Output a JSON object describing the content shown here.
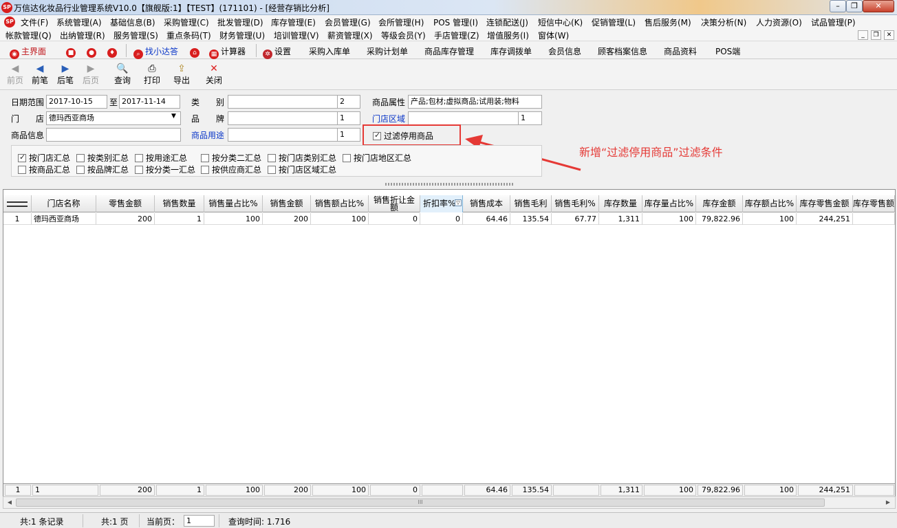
{
  "window": {
    "logo": "SP",
    "title": "万信达化妆品行业管理系统V10.0【旗舰版:1】【TEST】(171101) - [经营存销比分析]",
    "btn_min": "–",
    "btn_restore": "❐",
    "btn_close": "✕"
  },
  "menu1": [
    "文件(F)",
    "系统管理(A)",
    "基础信息(B)",
    "采购管理(C)",
    "批发管理(D)",
    "库存管理(E)",
    "会员管理(G)",
    "会所管理(H)",
    "POS 管理(I)",
    "连锁配送(J)",
    "短信中心(K)",
    "促销管理(L)",
    "售后服务(M)",
    "决策分析(N)",
    "人力资源(O)",
    "试品管理(P)"
  ],
  "menu2": [
    "帐款管理(Q)",
    "出纳管理(R)",
    "服务管理(S)",
    "重点条码(T)",
    "财务管理(U)",
    "培训管理(V)",
    "薪资管理(X)",
    "等级会员(Y)",
    "手店管理(Z)",
    "增值服务(I)",
    "窗体(W)"
  ],
  "mdi": {
    "minimize": "_",
    "restore": "❐",
    "close": "✕"
  },
  "quickbar": {
    "home": "主界面",
    "find": "找小达答",
    "calc": "计算器",
    "settings": "设置",
    "links": [
      "采购入库单",
      "采购计划单",
      "商品库存管理",
      "库存调拨单",
      "会员信息",
      "顾客档案信息",
      "商品资料",
      "POS端"
    ]
  },
  "toolbar": {
    "first": "前页",
    "prev": "前笔",
    "next": "后笔",
    "last": "后页",
    "query": "查询",
    "print": "打印",
    "export": "导出",
    "close": "关闭"
  },
  "filters": {
    "date_label": "日期范围",
    "date_from": "2017-10-15",
    "date_to_label": "至",
    "date_to": "2017-11-14",
    "category_label": "类　　别",
    "category_count": "2",
    "attr_label": "商品属性",
    "attr_value": "产品;包材;虚拟商品;试用装;物料",
    "store_label": "门　　店",
    "store_value": "德玛西亚商场",
    "brand_label": "品　　牌",
    "brand_count": "1",
    "region_label": "门店区域",
    "region_count": "1",
    "product_label": "商品信息",
    "usage_label": "商品用途",
    "usage_count": "1",
    "filter_disabled": "过滤停用商品"
  },
  "summary_options": [
    {
      "label": "按门店汇总",
      "checked": true
    },
    {
      "label": "按类别汇总",
      "checked": false
    },
    {
      "label": "按用途汇总",
      "checked": false
    },
    {
      "label": "按分类二汇总",
      "checked": false
    },
    {
      "label": "按门店类别汇总",
      "checked": false
    },
    {
      "label": "按门店地区汇总",
      "checked": false
    },
    {
      "label": "按商品汇总",
      "checked": false
    },
    {
      "label": "按品牌汇总",
      "checked": false
    },
    {
      "label": "按分类一汇总",
      "checked": false
    },
    {
      "label": "按供应商汇总",
      "checked": false
    },
    {
      "label": "按门店区域汇总",
      "checked": false
    }
  ],
  "annotation": "新增“过滤停用商品”过滤条件",
  "grid": {
    "headers": [
      "",
      "门店名称",
      "零售金额",
      "销售数量",
      "销售量占比%",
      "销售金额",
      "销售额占比%",
      "销售折让金额",
      "折扣率%",
      "销售成本",
      "销售毛利",
      "销售毛利%",
      "库存数量",
      "库存量占比%",
      "库存金额",
      "库存额占比%",
      "库存零售金额",
      "库存零售额"
    ],
    "row": [
      "1",
      "德玛西亚商场",
      "200",
      "1",
      "100",
      "200",
      "100",
      "0",
      "0",
      "64.46",
      "135.54",
      "67.77",
      "1,311",
      "100",
      "79,822.96",
      "100",
      "244,251",
      ""
    ],
    "footer": [
      "1",
      "1",
      "",
      "200",
      "1",
      "100",
      "200",
      "100",
      "0",
      "",
      "64.46",
      "135.54",
      "",
      "1,311",
      "100",
      "79,822.96",
      "100",
      "244,251"
    ]
  },
  "hscroll_grip": "III",
  "status": {
    "records": "共:1 条记录",
    "pages": "共:1 页",
    "current_label": "当前页：",
    "current_value": "1",
    "query_time": "查询时间: 1.716"
  }
}
